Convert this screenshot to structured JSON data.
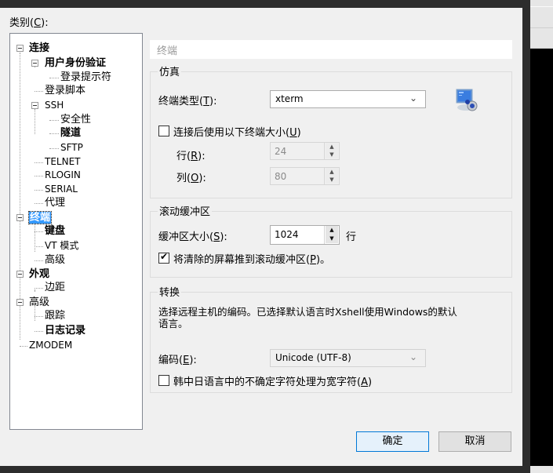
{
  "category_label": {
    "text": "类别",
    "mnemonic": "C",
    "suffix": ":"
  },
  "tree": [
    {
      "label": "连接",
      "bold": true,
      "expanded": true
    },
    {
      "label": "用户身份验证",
      "bold": true,
      "expanded": true
    },
    {
      "label": "登录提示符"
    },
    {
      "label": "登录脚本"
    },
    {
      "label": "SSH",
      "expanded": true
    },
    {
      "label": "安全性"
    },
    {
      "label": "隧道",
      "bold": true
    },
    {
      "label": "SFTP"
    },
    {
      "label": "TELNET"
    },
    {
      "label": "RLOGIN"
    },
    {
      "label": "SERIAL"
    },
    {
      "label": "代理"
    },
    {
      "label": "终端",
      "bold": true,
      "expanded": true,
      "selected": true
    },
    {
      "label": "键盘",
      "bold": true
    },
    {
      "label": "VT 模式"
    },
    {
      "label": "高级"
    },
    {
      "label": "外观",
      "bold": true,
      "expanded": true
    },
    {
      "label": "边距"
    },
    {
      "label": "高级",
      "expanded": true
    },
    {
      "label": "跟踪"
    },
    {
      "label": "日志记录",
      "bold": true
    },
    {
      "label": "ZMODEM"
    }
  ],
  "panel_title": "终端",
  "emulation": {
    "title": "仿真",
    "terminal_type_label": "终端类型",
    "terminal_type_mnemonic": "T",
    "terminal_type_value": "xterm",
    "use_size_label": "连接后使用以下终端大小",
    "use_size_mnemonic": "U",
    "use_size_checked": false,
    "rows_label": "行",
    "rows_mnemonic": "R",
    "rows_value": "24",
    "cols_label": "列",
    "cols_mnemonic": "O",
    "cols_value": "80",
    "icon": "terminal-settings-icon"
  },
  "scrollback": {
    "title": "滚动缓冲区",
    "size_label": "缓冲区大小",
    "size_mnemonic": "S",
    "size_value": "1024",
    "size_unit": "行",
    "push_label": "将清除的屏幕推到滚动缓冲区",
    "push_mnemonic": "P",
    "push_suffix": "。",
    "push_checked": true
  },
  "translation": {
    "title": "转换",
    "description_line1": "选择远程主机的编码。已选择默认语言时Xshell使用Windows的默认",
    "description_line2": "语言。",
    "encoding_label": "编码",
    "encoding_mnemonic": "E",
    "encoding_value": "Unicode (UTF-8)",
    "cjk_label": "韩中日语言中的不确定字符处理为宽字符",
    "cjk_mnemonic": "A",
    "cjk_checked": false
  },
  "buttons": {
    "ok": "确定",
    "cancel": "取消"
  },
  "colors": {
    "selection": "#3399ff",
    "default_button_border": "#0078d7"
  }
}
